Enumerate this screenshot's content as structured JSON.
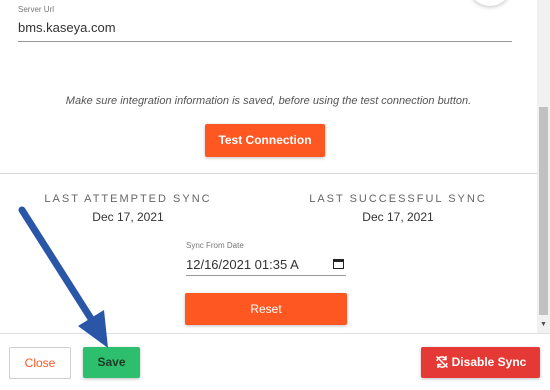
{
  "server_url": {
    "label": "Server Url",
    "value": "bms.kaseya.com"
  },
  "notice": "Make sure integration information is saved, before using the test connection button.",
  "test_connection_label": "Test Connection",
  "sync": {
    "last_attempted_label": "LAST ATTEMPTED SYNC",
    "last_attempted_date": "Dec 17, 2021",
    "last_successful_label": "LAST SUCCESSFUL SYNC",
    "last_successful_date": "Dec 17, 2021",
    "from_label": "Sync From Date",
    "from_value": "12/16/2021 01:35 A",
    "reset_label": "Reset"
  },
  "footer": {
    "close_label": "Close",
    "save_label": "Save",
    "disable_label": "Disable Sync"
  },
  "colors": {
    "accent_orange": "#ff5722",
    "save_green": "#2dbf6e",
    "disable_red": "#e53935",
    "annotation_arrow": "#2a56a8"
  },
  "icons": {
    "calendar": "calendar-icon",
    "disable": "sync-disabled-icon",
    "scroll_down": "scroll-down-arrow-icon"
  }
}
